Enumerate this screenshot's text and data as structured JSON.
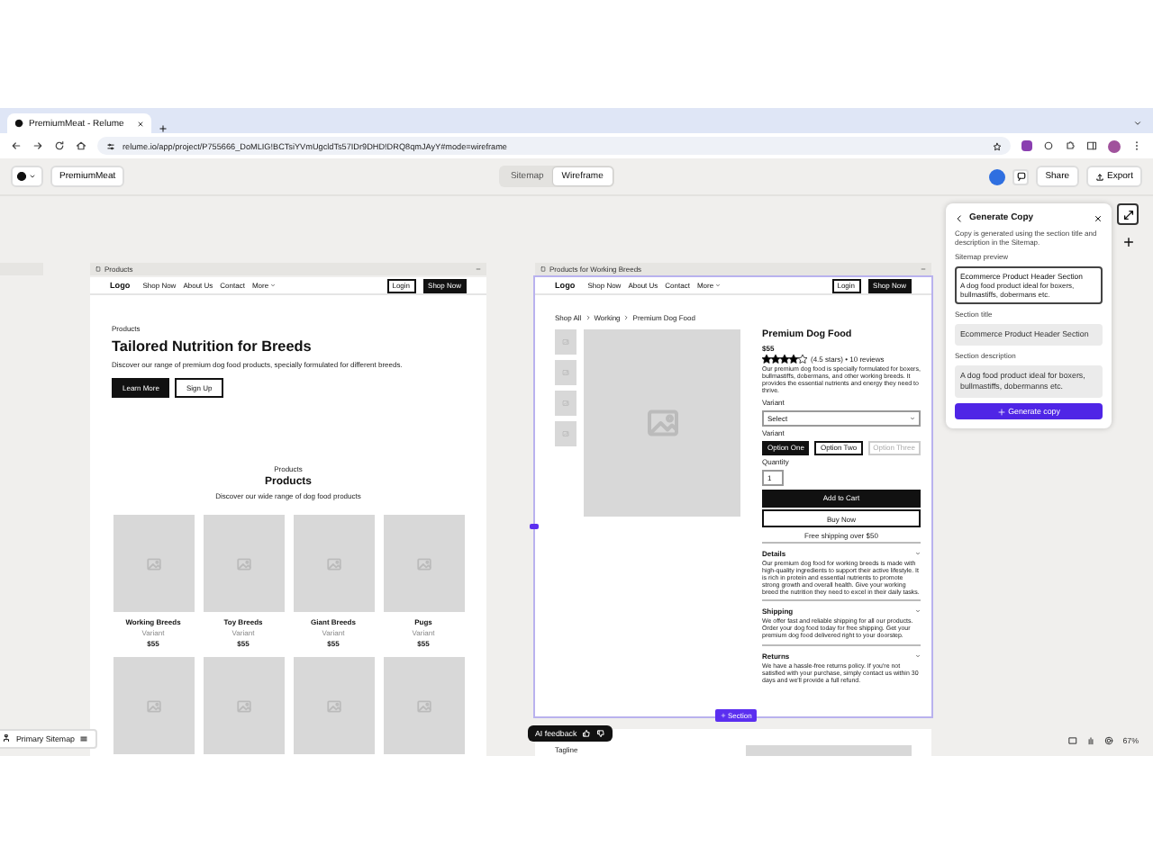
{
  "browser": {
    "tab_title": "PremiumMeat - Relume",
    "url": "relume.io/app/project/P755666_DoMLIG!BCTsiYVmUgcldTs57IDr9DHD!DRQ8qmJAyY#mode=wireframe"
  },
  "toolbar": {
    "project": "PremiumMeat",
    "view_tabs": [
      {
        "label": "Sitemap",
        "selected": false
      },
      {
        "label": "Wireframe",
        "selected": true
      }
    ],
    "buttons": [
      "Share",
      "Export"
    ]
  },
  "left_frame": {
    "title": "Products",
    "nav": {
      "logo": "Logo",
      "links": [
        "Shop Now",
        "About Us",
        "Contact",
        "More"
      ],
      "buttons": [
        "Login",
        "Shop Now"
      ]
    },
    "hero": {
      "tagline": "Products",
      "heading": "Tailored Nutrition for Breeds",
      "text": "Discover our range of premium dog food products, specially formulated for different breeds.",
      "buttons": [
        "Learn More",
        "Sign Up"
      ]
    },
    "products": {
      "tagline": "Products",
      "heading": "Products",
      "text": "Discover our wide range of dog food products",
      "items": [
        {
          "name": "Working Breeds",
          "variant": "Variant",
          "price": "$55"
        },
        {
          "name": "Toy Breeds",
          "variant": "Variant",
          "price": "$55"
        },
        {
          "name": "Giant Breeds",
          "variant": "Variant",
          "price": "$55"
        },
        {
          "name": "Pugs",
          "variant": "Variant",
          "price": "$55"
        }
      ]
    }
  },
  "right_frame": {
    "title": "Products for Working Breeds",
    "nav": {
      "logo": "Logo",
      "links": [
        "Shop Now",
        "About Us",
        "Contact",
        "More"
      ],
      "buttons": [
        "Login",
        "Shop Now"
      ]
    },
    "breadcrumb": [
      "Shop All",
      "Working",
      "Premium Dog Food"
    ],
    "product": {
      "name": "Premium Dog Food",
      "price": "$55",
      "stars": 4,
      "rating": "(4.5 stars) • 10 reviews",
      "description": "Our premium dog food is specially formulated for boxers, bullmastiffs, dobermans, and other working breeds. It provides the essential nutrients and energy they need to thrive.",
      "select_label": "Variant",
      "select": "Select",
      "options_label": "Variant",
      "options": [
        {
          "label": "Option One",
          "selected": true,
          "disabled": false
        },
        {
          "label": "Option Two",
          "selected": false,
          "disabled": false
        },
        {
          "label": "Option Three",
          "selected": false,
          "disabled": true
        }
      ],
      "quantity_label": "Quantity",
      "quantity": "1",
      "primary": "Add to Cart",
      "secondary": "Buy Now",
      "note": "Free shipping over $50",
      "accordion": [
        {
          "title": "Details",
          "body": "Our premium dog food for working breeds is made with high-quality ingredients to support their active lifestyle. It is rich in protein and essential nutrients to promote strong growth and overall health. Give your working breed the nutrition they need to excel in their daily tasks."
        },
        {
          "title": "Shipping",
          "body": "We offer fast and reliable shipping for all our products. Order your dog food today for free shipping. Get your premium dog food delivered right to your doorstep."
        },
        {
          "title": "Returns",
          "body": "We have a hassle-free returns policy. If you're not satisfied with your purchase, simply contact us within 30 days and we'll provide a full refund."
        }
      ]
    },
    "badge": "Section",
    "next_tagline": "Tagline"
  },
  "panel": {
    "title": "Generate Copy",
    "intro": "Copy is generated using the section title and description in the Sitemap.",
    "preview_label": "Sitemap preview",
    "preview_title": "Ecommerce Product Header Section",
    "preview_text": "A dog food product ideal for boxers, bullmastiffs, dobermans etc.",
    "title_label": "Section title",
    "section_title": "Ecommerce Product Header Section",
    "desc_label": "Section description",
    "section_description": "A dog food product ideal for boxers, bullmastiffs, dobermanns etc.",
    "button": "Generate copy"
  },
  "bottom": {
    "sitemap": "Primary Sitemap",
    "feedback": "AI feedback",
    "zoom": "67%"
  }
}
